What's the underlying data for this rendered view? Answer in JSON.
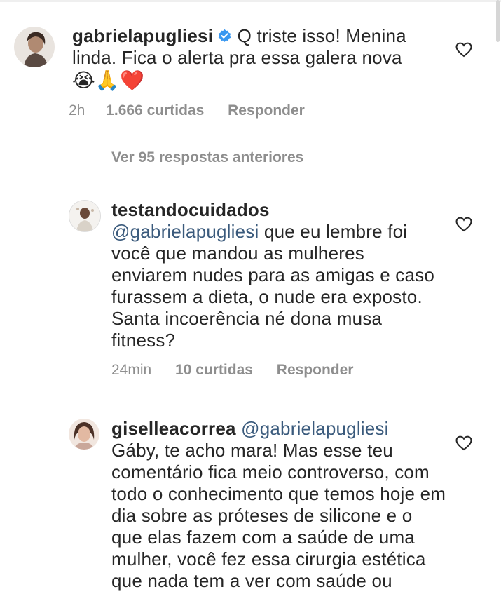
{
  "comments": [
    {
      "username": "gabrielapugliesi",
      "verified": true,
      "text": "Q triste isso! Menina linda. Fica o alerta pra essa galera nova",
      "emojis": "😭🙏❤️",
      "time": "2h",
      "likes": "1.666 curtidas",
      "reply": "Responder"
    },
    {
      "username": "testandocuidados",
      "mention": "@gabrielapugliesi",
      "text": " que eu lembre foi você que mandou as mulheres enviarem nudes para as amigas e caso furassem a dieta, o nude era exposto. Santa incoerência né dona musa fitness?",
      "time": "24min",
      "likes": "10 curtidas",
      "reply": "Responder"
    },
    {
      "username": "giselleacorrea",
      "mention": "@gabrielapugliesi",
      "text": "Gáby, te acho mara! Mas esse teu comentário fica meio controverso, com todo o conhecimento que temos hoje em dia sobre as próteses de silicone e o que elas fazem com a saúde de uma mulher, você fez essa cirurgia estética que nada tem a ver com saúde ou"
    }
  ],
  "view_more": "Ver 95 respostas anteriores",
  "icons": {
    "heart": "heart-outline-icon",
    "verified": "verified-badge-icon"
  },
  "colors": {
    "meta": "#8e8e8e",
    "mention": "#3a5a7c",
    "verified": "#3897f0"
  }
}
